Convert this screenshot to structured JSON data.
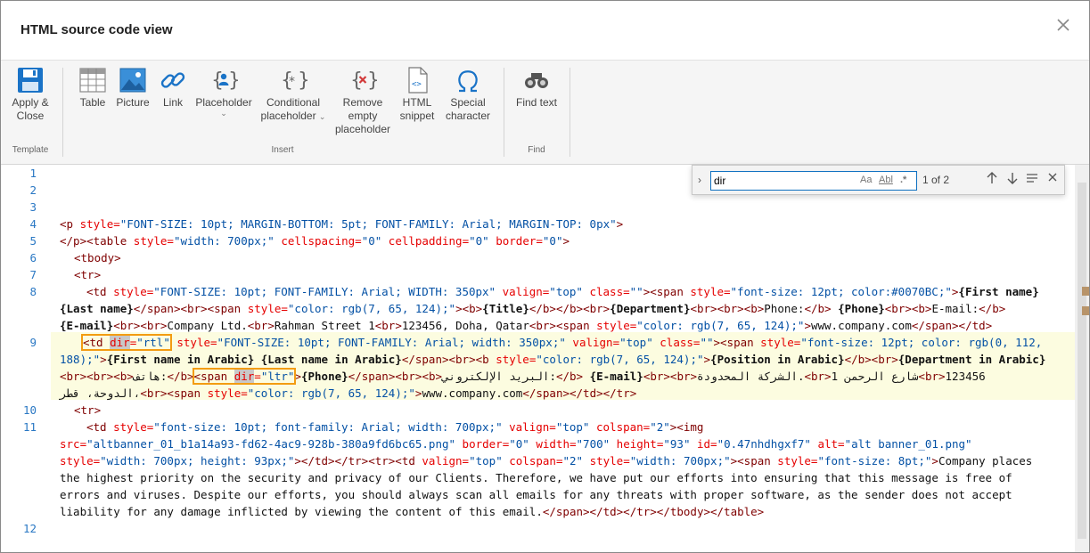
{
  "dialog": {
    "title": "HTML source code view"
  },
  "ribbon": {
    "groups": {
      "template": "Template",
      "insert": "Insert",
      "find": "Find"
    },
    "buttons": {
      "apply": [
        "Apply &",
        "Close"
      ],
      "table": "Table",
      "picture": "Picture",
      "link": "Link",
      "placeholder": "Placeholder",
      "conditional": [
        "Conditional",
        "placeholder"
      ],
      "remove_empty": [
        "Remove",
        "empty",
        "placeholder"
      ],
      "html_snippet": [
        "HTML",
        "snippet"
      ],
      "special_char": [
        "Special",
        "character"
      ],
      "find_text": "Find text"
    },
    "accent": "#0e70c0"
  },
  "find": {
    "value": "dir",
    "count": "1 of 2",
    "options": {
      "case": "Aa",
      "word": "Abl",
      "regex": ".*"
    }
  },
  "editor": {
    "line_numbers": [
      "1",
      "2",
      "3",
      "4",
      "5",
      "6",
      "7",
      "8",
      "9",
      "10",
      "11",
      "12"
    ],
    "colors": {
      "tag": "#7f0000",
      "attr": "#e50000",
      "value": "#0451a5",
      "line_number": "#2a78c4",
      "highlight": "#fcfce0",
      "match_box": "#f39c12"
    },
    "l4": [
      "<p",
      " style=",
      "\"FONT-SIZE: 10pt; MARGIN-BOTTOM: 5pt; FONT-FAMILY: Arial; MARGIN-TOP: 0px\"",
      ">"
    ],
    "l5": [
      "</p>",
      "<table",
      " style=",
      "\"width: 700px;\"",
      " cellspacing=",
      "\"0\"",
      " cellpadding=",
      "\"0\"",
      " border=",
      "\"0\"",
      ">"
    ],
    "l6": "<tbody>",
    "l7": "<tr>",
    "l8a": [
      "<td",
      " style=",
      "\"FONT-SIZE: 10pt; FONT-FAMILY: Arial; WIDTH: 350px\"",
      " valign=",
      "\"top\"",
      " class=",
      "\"\"",
      "><span",
      " style=",
      "\"font-size: 12pt; color:#0070BC;\"",
      ">",
      "{First name}"
    ],
    "l8b": [
      "{Last name}",
      "</span><br><span",
      " style=",
      "\"color: rgb(7, 65, 124);\"",
      "><b>",
      "{Title}",
      "</b></b><br>",
      "{Department}",
      "<br><br><b>",
      "Phone:",
      "</b>",
      " {Phone}",
      "<br><b>",
      "E-mail:",
      "</b>"
    ],
    "l8c": [
      "{E-mail}",
      "<br><br>",
      "Company Ltd.",
      "<br>",
      "Rahman Street 1",
      "<br>",
      "123456, Doha, Qatar",
      "<br><span",
      " style=",
      "\"color: rgb(7, 65, 124);\"",
      ">",
      "www.company.com",
      "</span></td>"
    ],
    "l9a": [
      "<td ",
      "dir",
      "=",
      "\"rtl\"",
      " style=",
      "\"FONT-SIZE: 10pt; FONT-FAMILY: Arial; width: 350px;\"",
      " valign=",
      "\"top\"",
      " class=",
      "\"\"",
      "><span",
      " style=",
      "\"font-size: 12pt; color: rgb(0, 112,"
    ],
    "l9b": [
      "188);\"",
      ">",
      "{First name in Arabic} {Last name in Arabic}",
      "</span><br><b",
      " style=",
      "\"color: rgb(7, 65, 124);\"",
      ">",
      "{Position in Arabic}",
      "</b><br>",
      "{Department in Arabic}"
    ],
    "l9c": [
      "<br><br><b>",
      "هاتف:",
      "</b>",
      "<span ",
      "dir",
      "=",
      "\"ltr\"",
      ">",
      "{Phone}",
      "</span><br><b>",
      "البريد الإلكتروني:",
      "</b>",
      " {E-mail}",
      "<br><br>",
      "الشركة المحدودة.",
      "<br>",
      "شارع الرحمن 1",
      "<br>",
      "123456"
    ],
    "l9d": [
      "الدوحة، قطر،",
      "<br><span",
      " style=",
      "\"color: rgb(7, 65, 124);\"",
      ">",
      "www.company.com",
      "</span></td></tr>"
    ],
    "l10": "<tr>",
    "l11a": [
      "<td",
      " style=",
      "\"font-size: 10pt; font-family: Arial; width: 700px;\"",
      " valign=",
      "\"top\"",
      " colspan=",
      "\"2\"",
      "><img"
    ],
    "l11b": [
      "src=",
      "\"altbanner_01_b1a14a93-fd62-4ac9-928b-380a9fd6bc65.png\"",
      " border=",
      "\"0\"",
      " width=",
      "\"700\"",
      " height=",
      "\"93\"",
      " id=",
      "\"0.47nhdhgxf7\"",
      " alt=",
      "\"alt banner_01.png\""
    ],
    "l11c": [
      "style=",
      "\"width: 700px; height: 93px;\"",
      "></td></tr><tr><td",
      " valign=",
      "\"top\"",
      " colspan=",
      "\"2\"",
      " style=",
      "\"width: 700px;\"",
      "><span",
      " style=",
      "\"font-size: 8pt;\"",
      ">",
      "Company places"
    ],
    "l11d": "the highest priority on the security and privacy of our Clients. Therefore, we have put our efforts into ensuring that this message is free of",
    "l11e": "errors and viruses. Despite our efforts, you should always scan all emails for any threats with proper software, as the sender does not accept",
    "l11f": [
      "liability for any damage inflicted by viewing the content of this email.",
      "</span></td></tr></tbody></table>"
    ]
  }
}
